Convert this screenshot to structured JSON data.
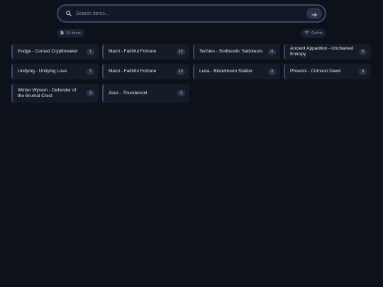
{
  "search": {
    "placeholder": "Search items..."
  },
  "meta": {
    "count_label": "10 items",
    "status_label": "Online"
  },
  "items": [
    {
      "title": "Pudge - Cursed Cryptbreaker",
      "count": "1"
    },
    {
      "title": "Marci - Faithful Fortune",
      "count": "12"
    },
    {
      "title": "Techies - Sodbustin' Saboteurs",
      "count": "4"
    },
    {
      "title": "Ancient Apparition - Unchained Entropy",
      "count": "5"
    },
    {
      "title": "Undying - Undying Love",
      "count": "7"
    },
    {
      "title": "Marci - Faithful Fortune",
      "count": "12"
    },
    {
      "title": "Luna - Bloodmoon Stalker",
      "count": "3"
    },
    {
      "title": "Phoenix - Crimson Dawn",
      "count": "3"
    },
    {
      "title": "Winter Wyvern - Defender of the Brumal Crest",
      "count": "3"
    },
    {
      "title": "Zeus - Thundervolt",
      "count": "3"
    }
  ]
}
